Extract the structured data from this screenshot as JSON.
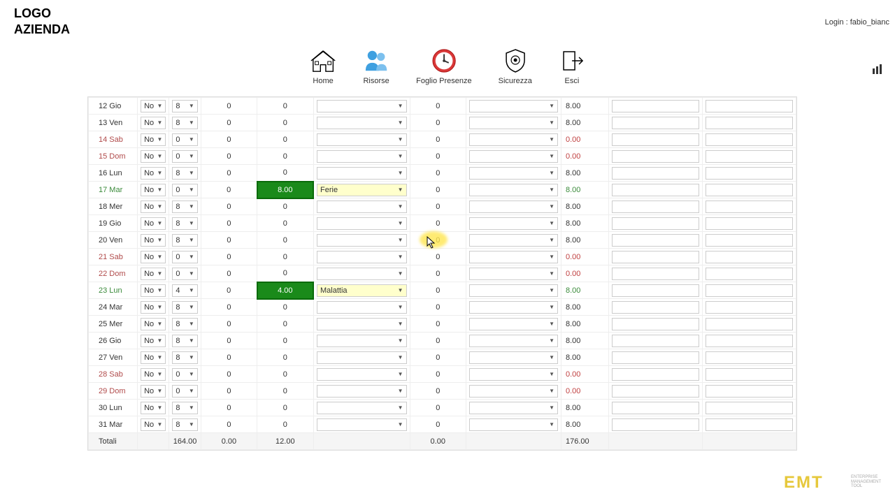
{
  "logo_line1": "LOGO",
  "logo_line2": "AZIENDA",
  "login_label": "Login : fabio_bianc",
  "nav": {
    "home": "Home",
    "risorse": "Risorse",
    "foglio": "Foglio Presenze",
    "sicurezza": "Sicurezza",
    "esci": "Esci"
  },
  "rows": [
    {
      "date": "12 Gio",
      "no": "No",
      "hrs": "8",
      "n1": "0",
      "n2": "0",
      "sel1": "",
      "n3": "0",
      "sel2": "",
      "tot": "8.00",
      "cls": ""
    },
    {
      "date": "13 Ven",
      "no": "No",
      "hrs": "8",
      "n1": "0",
      "n2": "0",
      "sel1": "",
      "n3": "0",
      "sel2": "",
      "tot": "8.00",
      "cls": ""
    },
    {
      "date": "14 Sab",
      "no": "No",
      "hrs": "0",
      "n1": "0",
      "n2": "0",
      "sel1": "",
      "n3": "0",
      "sel2": "",
      "tot": "0.00",
      "cls": "weekend",
      "red": true
    },
    {
      "date": "15 Dom",
      "no": "No",
      "hrs": "0",
      "n1": "0",
      "n2": "0",
      "sel1": "",
      "n3": "0",
      "sel2": "",
      "tot": "0.00",
      "cls": "weekend",
      "red": true
    },
    {
      "date": "16 Lun",
      "no": "No",
      "hrs": "8",
      "n1": "0",
      "n2": "0",
      "sel1": "",
      "n3": "0",
      "sel2": "",
      "tot": "8.00",
      "cls": ""
    },
    {
      "date": "17 Mar",
      "no": "No",
      "hrs": "0",
      "n1": "0",
      "n2": "8.00",
      "sel1": "Ferie",
      "n3": "0",
      "sel2": "",
      "tot": "8.00",
      "cls": "green",
      "abs": true,
      "greentot": true
    },
    {
      "date": "18 Mer",
      "no": "No",
      "hrs": "8",
      "n1": "0",
      "n2": "0",
      "sel1": "",
      "n3": "0",
      "sel2": "",
      "tot": "8.00",
      "cls": ""
    },
    {
      "date": "19 Gio",
      "no": "No",
      "hrs": "8",
      "n1": "0",
      "n2": "0",
      "sel1": "",
      "n3": "0",
      "sel2": "",
      "tot": "8.00",
      "cls": ""
    },
    {
      "date": "20 Ven",
      "no": "No",
      "hrs": "8",
      "n1": "0",
      "n2": "0",
      "sel1": "",
      "n3": "0",
      "sel2": "",
      "tot": "8.00",
      "cls": ""
    },
    {
      "date": "21 Sab",
      "no": "No",
      "hrs": "0",
      "n1": "0",
      "n2": "0",
      "sel1": "",
      "n3": "0",
      "sel2": "",
      "tot": "0.00",
      "cls": "weekend",
      "red": true
    },
    {
      "date": "22 Dom",
      "no": "No",
      "hrs": "0",
      "n1": "0",
      "n2": "0",
      "sel1": "",
      "n3": "0",
      "sel2": "",
      "tot": "0.00",
      "cls": "weekend",
      "red": true
    },
    {
      "date": "23 Lun",
      "no": "No",
      "hrs": "4",
      "n1": "0",
      "n2": "4.00",
      "sel1": "Malattia",
      "n3": "0",
      "sel2": "",
      "tot": "8.00",
      "cls": "green",
      "abs": true,
      "greentot": true
    },
    {
      "date": "24 Mar",
      "no": "No",
      "hrs": "8",
      "n1": "0",
      "n2": "0",
      "sel1": "",
      "n3": "0",
      "sel2": "",
      "tot": "8.00",
      "cls": ""
    },
    {
      "date": "25 Mer",
      "no": "No",
      "hrs": "8",
      "n1": "0",
      "n2": "0",
      "sel1": "",
      "n3": "0",
      "sel2": "",
      "tot": "8.00",
      "cls": ""
    },
    {
      "date": "26 Gio",
      "no": "No",
      "hrs": "8",
      "n1": "0",
      "n2": "0",
      "sel1": "",
      "n3": "0",
      "sel2": "",
      "tot": "8.00",
      "cls": ""
    },
    {
      "date": "27 Ven",
      "no": "No",
      "hrs": "8",
      "n1": "0",
      "n2": "0",
      "sel1": "",
      "n3": "0",
      "sel2": "",
      "tot": "8.00",
      "cls": ""
    },
    {
      "date": "28 Sab",
      "no": "No",
      "hrs": "0",
      "n1": "0",
      "n2": "0",
      "sel1": "",
      "n3": "0",
      "sel2": "",
      "tot": "0.00",
      "cls": "weekend",
      "red": true
    },
    {
      "date": "29 Dom",
      "no": "No",
      "hrs": "0",
      "n1": "0",
      "n2": "0",
      "sel1": "",
      "n3": "0",
      "sel2": "",
      "tot": "0.00",
      "cls": "weekend",
      "red": true
    },
    {
      "date": "30 Lun",
      "no": "No",
      "hrs": "8",
      "n1": "0",
      "n2": "0",
      "sel1": "",
      "n3": "0",
      "sel2": "",
      "tot": "8.00",
      "cls": ""
    },
    {
      "date": "31 Mar",
      "no": "No",
      "hrs": "8",
      "n1": "0",
      "n2": "0",
      "sel1": "",
      "n3": "0",
      "sel2": "",
      "tot": "8.00",
      "cls": ""
    }
  ],
  "totals": {
    "label": "Totali",
    "hrs": "164.00",
    "n1": "0.00",
    "n2": "12.00",
    "n3": "0.00",
    "tot": "176.00"
  },
  "footer": {
    "brand": "EMT",
    "sub1": "ENTERPRISE",
    "sub2": "MANAGEMENT",
    "sub3": "TOOL"
  }
}
